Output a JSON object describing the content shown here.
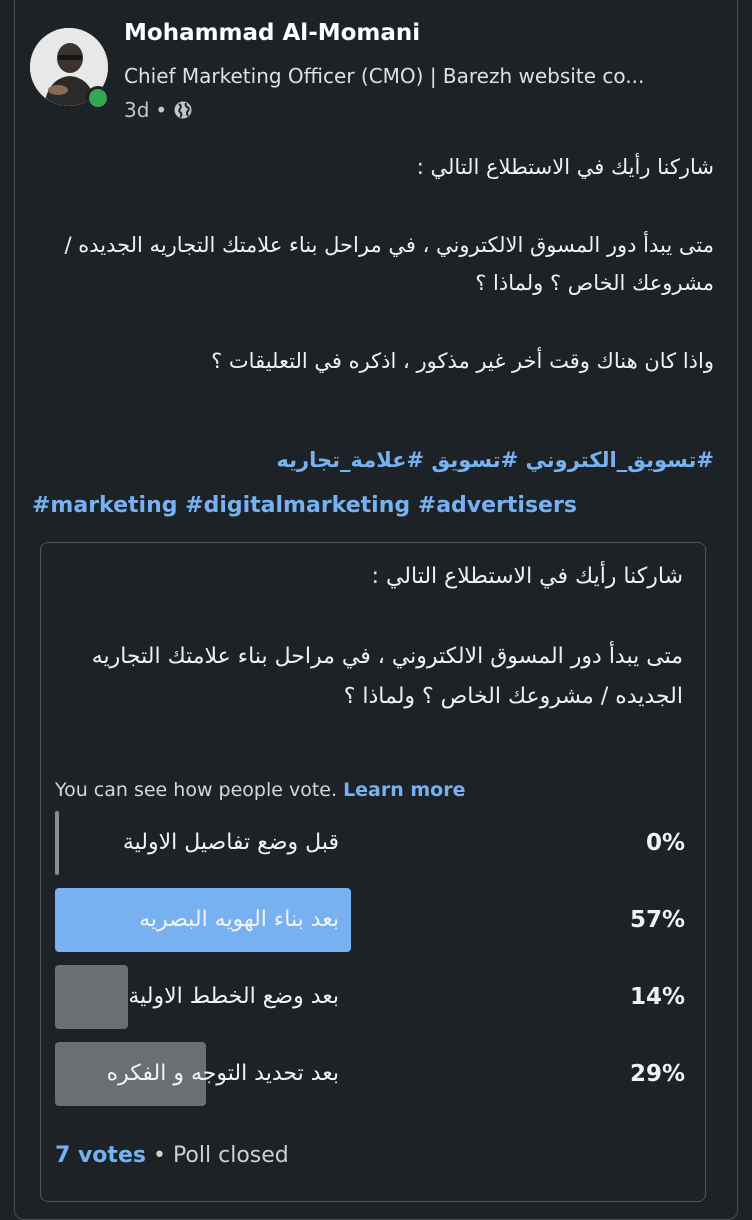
{
  "post": {
    "author": {
      "name": "Mohammad Al-Momani",
      "headline": "Chief Marketing Officer (CMO) | Barezh website co...",
      "time": "3d",
      "separator": "•"
    },
    "body": {
      "line1": "شاركنا رأيك في الاستطلاع التالي :",
      "line2": "متى يبدأ دور المسوق الالكتروني ، في مراحل بناء علامتك التجاريه الجديده / مشروعك الخاص ؟ ولماذا ؟",
      "line3": "واذا كان هناك وقت أخر غير مذكور ، اذكره في التعليقات ؟"
    },
    "hashtags_ar": "#تسويق_الكتروني #تسويق #علامة_تجاريه",
    "hashtags_en": "#marketing #digitalmarketing #advertisers"
  },
  "poll": {
    "question_line1": "شاركنا رأيك في الاستطلاع التالي :",
    "question_line2": "متى يبدأ دور المسوق الالكتروني ، في مراحل بناء علامتك التجاريه الجديده / مشروعك الخاص ؟ ولماذا ؟",
    "visibility_note": "You can see how people vote.",
    "learn_more": "Learn more",
    "options": [
      {
        "label": "قبل وضع تفاصيل الاولية",
        "percent": "0%",
        "fraction": 0.0,
        "highlighted": false
      },
      {
        "label": "بعد بناء الهويه البصريه",
        "percent": "57%",
        "fraction": 0.57,
        "highlighted": true
      },
      {
        "label": "بعد وضع الخطط الاولية",
        "percent": "14%",
        "fraction": 0.14,
        "highlighted": false
      },
      {
        "label": "بعد تحديد التوجه و الفكره",
        "percent": "29%",
        "fraction": 0.29,
        "highlighted": false
      }
    ],
    "votes": "7 votes",
    "separator": "•",
    "status": "Poll closed"
  },
  "colors": {
    "background": "#1d2226",
    "link": "#78b1f2",
    "bar_selected": "#78b1f2",
    "bar_default": "#6b6f73",
    "presence": "#34a853"
  }
}
